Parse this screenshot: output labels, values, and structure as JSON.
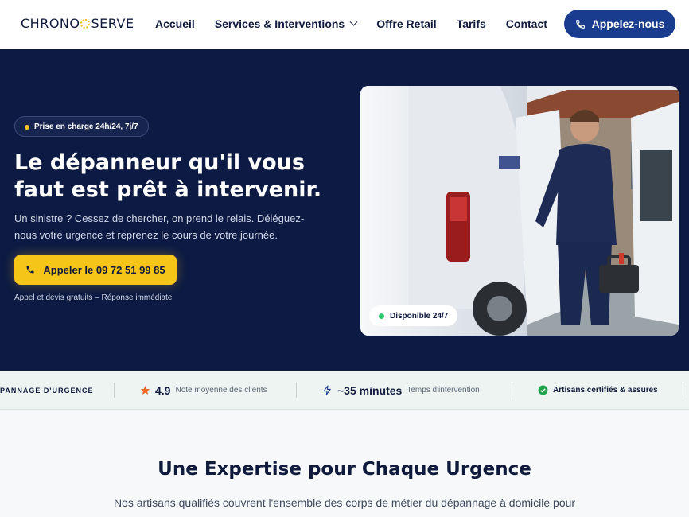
{
  "header": {
    "logo_left": "CHRONO",
    "logo_right": "SERVE",
    "nav": [
      "Accueil",
      "Services & Interventions",
      "Offre Retail",
      "Tarifs",
      "Contact"
    ],
    "call_button": "Appelez-nous"
  },
  "hero": {
    "badge": "Prise en charge 24h/24, 7j/7",
    "title": "Le dépanneur qu'il vous faut est prêt à intervenir.",
    "text": "Un sinistre ? Cessez de chercher, on prend le relais. Déléguez-nous votre urgence et reprenez le cours de votre journée.",
    "cta": "Appeler le 09 72 51 99 85",
    "note": "Appel et devis gratuits – Réponse immédiate",
    "availability": "Disponible 24/7"
  },
  "stats": {
    "label": "PANNAGE D'URGENCE",
    "rating_value": "4.9",
    "rating_text": "Note moyenne des clients",
    "time_value": "~35 minutes",
    "time_text": "Temps d'intervention",
    "certified_text": "Artisans certifiés & assurés"
  },
  "section": {
    "title": "Une Expertise pour Chaque Urgence",
    "text": "Nos artisans qualifiés couvrent l'ensemble des corps de métier du dépannage à domicile pour"
  },
  "colors": {
    "navy": "#0c1a44",
    "accent_blue": "#1a3c8f",
    "yellow": "#f5c518",
    "green": "#2ecc71"
  }
}
